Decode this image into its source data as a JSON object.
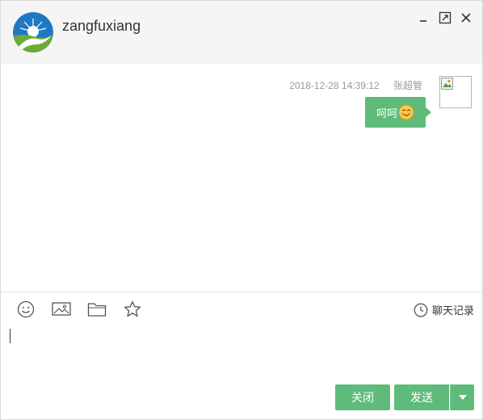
{
  "header": {
    "username": "zangfuxiang",
    "controls": [
      {
        "name": "minimize",
        "icon": "minimize-icon"
      },
      {
        "name": "maximize",
        "icon": "maximize-icon"
      },
      {
        "name": "close",
        "icon": "close-icon"
      }
    ]
  },
  "messages": [
    {
      "time": "2018-12-28 14:39:12",
      "sender": "张超管",
      "text": "呵呵",
      "emoji": "smiling-face-emoji",
      "avatar": "broken-image-icon"
    }
  ],
  "toolbar": {
    "tools": [
      "emoji-icon",
      "image-icon",
      "folder-icon",
      "star-icon"
    ],
    "history_label": "聊天记录",
    "history_icon": "clock-icon"
  },
  "input": {
    "value": "",
    "placeholder": ""
  },
  "buttons": {
    "close_label": "关闭",
    "send_label": "发送",
    "dropdown_icon": "caret-down-icon"
  },
  "colors": {
    "accent": "#5fbb7a",
    "header_bg": "#f5f5f5",
    "meta_text": "#999999"
  }
}
